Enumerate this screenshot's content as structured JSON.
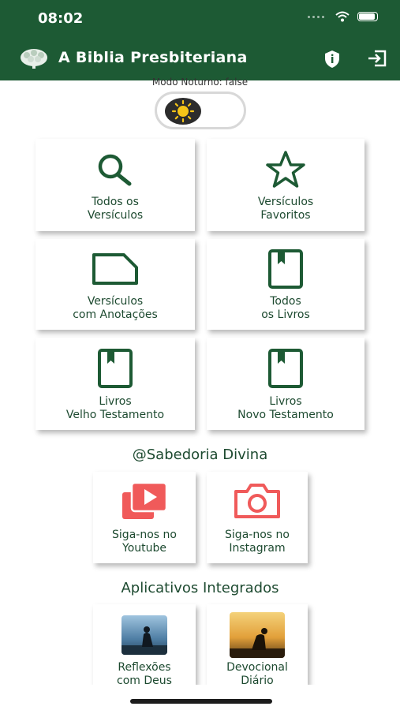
{
  "status": {
    "time": "08:02"
  },
  "header": {
    "title": "A Biblia Presbiteriana",
    "logo": "tree-icon",
    "actions": [
      "shield-icon",
      "logout-icon"
    ]
  },
  "night_mode": {
    "label": "Modo Noturno: false",
    "icon": "sun-icon"
  },
  "menu": [
    {
      "line1": "Todos os",
      "line2": "Versículos",
      "icon": "search-icon"
    },
    {
      "line1": "Versículos",
      "line2": "Favoritos",
      "icon": "star-icon"
    },
    {
      "line1": "Versículos",
      "line2": "com Anotações",
      "icon": "note-icon"
    },
    {
      "line1": "Todos",
      "line2": "os Livros",
      "icon": "book-icon"
    },
    {
      "line1": "Livros",
      "line2": "Velho Testamento",
      "icon": "book-icon"
    },
    {
      "line1": "Livros",
      "line2": "Novo Testamento",
      "icon": "book-icon"
    }
  ],
  "social": {
    "title": "@Sabedoria Divina",
    "items": [
      {
        "line1": "Siga-nos no",
        "line2": "Youtube",
        "icon": "youtube-icon",
        "color": "#f05a5a"
      },
      {
        "line1": "Siga-nos no",
        "line2": "Instagram",
        "icon": "camera-icon",
        "color": "#f05a5a"
      }
    ]
  },
  "apps": {
    "title": "Aplicativos Integrados",
    "items": [
      {
        "line1": "Reflexões",
        "line2": "com Deus"
      },
      {
        "line1": "Devocional",
        "line2": "Diário"
      }
    ]
  },
  "colors": {
    "primary": "#1d5a34",
    "icon_green": "#1d5a34",
    "social_red": "#f05a5a"
  }
}
